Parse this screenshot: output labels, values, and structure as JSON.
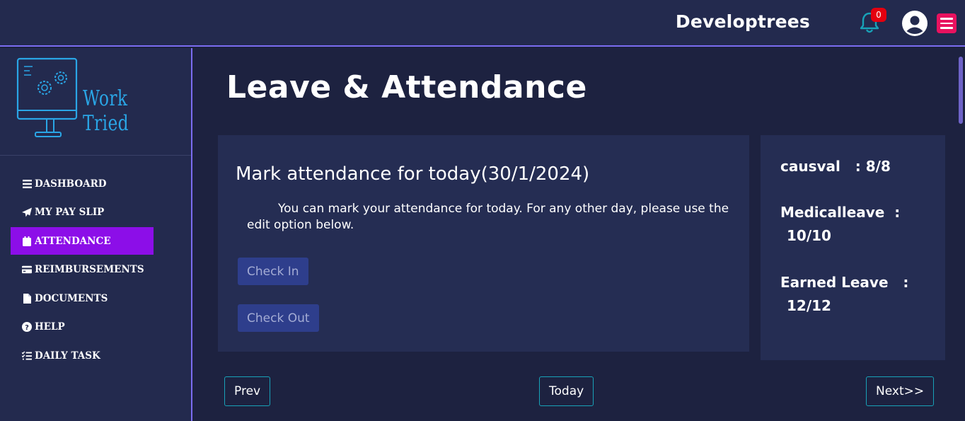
{
  "header": {
    "brand": "Developtrees",
    "notification_count": "0",
    "icons": [
      "bell-icon",
      "user-circle-icon",
      "hamburger-menu-icon"
    ],
    "accent_color": "#7b6cf0",
    "menu_button_color": "#e8125f"
  },
  "sidebar": {
    "logo_text": "Work Tried",
    "items": [
      {
        "label": "DASHBOARD",
        "icon": "bars-icon"
      },
      {
        "label": "MY PAY SLIP",
        "icon": "paper-plane-icon"
      },
      {
        "label": "ATTENDANCE",
        "icon": "calendar-icon",
        "active": true
      },
      {
        "label": "REIMBURSEMENTS",
        "icon": "credit-card-icon"
      },
      {
        "label": "DOCUMENTS",
        "icon": "file-icon"
      },
      {
        "label": "HELP",
        "icon": "question-circle-icon"
      },
      {
        "label": "DAILY TASK",
        "icon": "task-list-icon"
      }
    ],
    "active_color": "#8c0ee8"
  },
  "main": {
    "title": "Leave & Attendance",
    "attendance": {
      "heading": "Mark attendance for today(30/1/2024)",
      "description": "You can mark your attendance for today. For any other day, please use the edit option below.",
      "check_in_label": "Check In",
      "check_out_label": "Check Out"
    },
    "leave": {
      "causval_label": "causval   :",
      "causval_value": "8/8",
      "medical_label": "Medicalleave  :",
      "medical_value": "10/10",
      "earned_label": "Earned Leave   :",
      "earned_value": "12/12"
    },
    "pager": {
      "prev_label": "Prev",
      "today_label": "Today",
      "next_label": "Next>>"
    }
  }
}
